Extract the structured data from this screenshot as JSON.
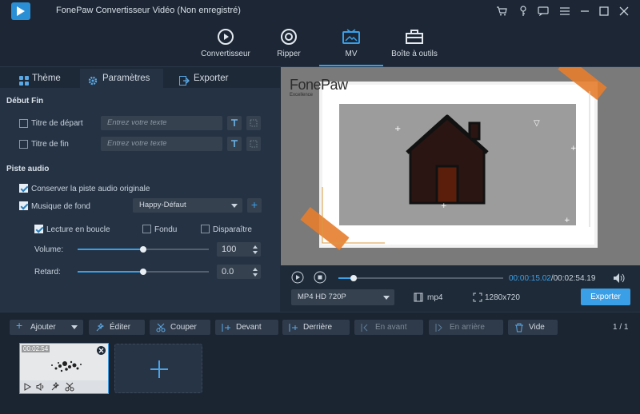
{
  "window": {
    "title": "FonePaw Convertisseur Vidéo (Non enregistré)"
  },
  "modes": [
    {
      "label": "Convertisseur",
      "icon": "convert-icon"
    },
    {
      "label": "Ripper",
      "icon": "disc-icon"
    },
    {
      "label": "MV",
      "icon": "mv-icon"
    },
    {
      "label": "Boîte à outils",
      "icon": "toolbox-icon"
    }
  ],
  "tabs": {
    "theme": "Thème",
    "params": "Paramètres",
    "export": "Exporter"
  },
  "debut_fin": {
    "section": "Début Fin",
    "start_label": "Titre de départ",
    "end_label": "Titre de fin",
    "placeholder": "Entrez votre texte"
  },
  "audio": {
    "section": "Piste audio",
    "keep_original": "Conserver la piste audio originale",
    "background_music": "Musique de fond",
    "music_select": "Happy-Défaut",
    "loop": "Lecture en boucle",
    "fade_in": "Fondu",
    "fade_out": "Disparaître",
    "volume_label": "Volume:",
    "volume_value": "100",
    "volume_level": 0.5,
    "delay_label": "Retard:",
    "delay_value": "0.0",
    "delay_level": 0.5
  },
  "preview": {
    "watermark": "FonePaw",
    "watermark_sub": "Excellence"
  },
  "player": {
    "time_current": "00:00:15.02",
    "time_total": "/00:02:54.19",
    "progress": 0.09,
    "format_select": "MP4 HD 720P",
    "format": "mp4",
    "resolution": "1280x720",
    "export_button": "Exporter"
  },
  "toolbar": {
    "add": "Ajouter",
    "edit": "Éditer",
    "cut": "Couper",
    "front": "Devant",
    "back": "Derrière",
    "forward": "En avant",
    "backward": "En arrière",
    "empty": "Vide",
    "page": "1 / 1"
  },
  "clip": {
    "duration": "00:02:54"
  }
}
